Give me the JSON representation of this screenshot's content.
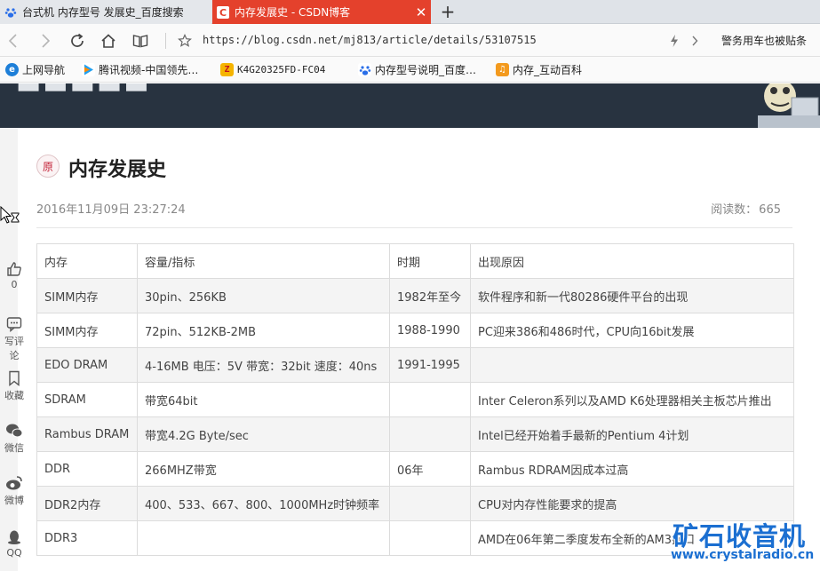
{
  "tabs": [
    {
      "title": "台式机 内存型号 发展史_百度搜索",
      "favicon": "baidu-paw-icon",
      "active": false
    },
    {
      "title": "内存发展史 - CSDN博客",
      "favicon": "csdn-c-icon",
      "active": true,
      "accent": "#e4412c"
    }
  ],
  "address": {
    "url": "https://blog.csdn.net/mj813/article/details/53107515",
    "right_text": "警务用车也被贴条"
  },
  "bookmarks": [
    {
      "label": "上网导航",
      "icon": "ie-e-icon"
    },
    {
      "label": "腾讯视频-中国领先…",
      "icon": "tencent-video-icon"
    },
    {
      "label": "K4G20325FD-FC04 ",
      "icon": "zol-icon"
    },
    {
      "label": "内存型号说明_百度…",
      "icon": "baidu-paw-icon"
    },
    {
      "label": "内存_互动百科",
      "icon": "hudong-icon"
    }
  ],
  "article": {
    "badge": "原",
    "title": "内存发展史",
    "date": "2016年11月09日 23:27:24",
    "views_label": "阅读数：",
    "views": "665"
  },
  "table": {
    "header": [
      "内存",
      "容量/指标",
      "时期",
      "出现原因"
    ],
    "rows": [
      [
        "SIMM内存",
        "30pin、256KB",
        "1982年至今",
        "软件程序和新一代80286硬件平台的出现"
      ],
      [
        "SIMM内存",
        "72pin、512KB-2MB",
        "1988-1990",
        "PC迎来386和486时代，CPU向16bit发展"
      ],
      [
        "EDO DRAM",
        "4-16MB 电压：5V 带宽：32bit 速度：40ns",
        "1991-1995",
        ""
      ],
      [
        "SDRAM",
        "带宽64bit",
        "",
        "Inter Celeron系列以及AMD K6处理器相关主板芯片推出"
      ],
      [
        "Rambus DRAM",
        "带宽4.2G Byte/sec",
        "",
        "Intel已经开始着手最新的Pentium 4计划"
      ],
      [
        "DDR",
        "266MHZ带宽",
        "06年",
        "Rambus RDRAM因成本过高"
      ],
      [
        "DDR2内存",
        "400、533、667、800、1000MHz时钟频率",
        "",
        "CPU对内存性能要求的提高"
      ],
      [
        "DDR3",
        "",
        "",
        "AMD在06年第二季度发布全新的AM3接口"
      ]
    ]
  },
  "rail": [
    {
      "label": "0",
      "icon": "thumbs-up-icon"
    },
    {
      "label": "写评论",
      "icon": "comment-icon"
    },
    {
      "label": "收藏",
      "icon": "bookmark-icon"
    },
    {
      "label": "微信",
      "icon": "wechat-icon"
    },
    {
      "label": "微博",
      "icon": "weibo-icon"
    },
    {
      "label": "QQ",
      "icon": "qq-icon"
    }
  ],
  "watermark": {
    "name": "矿石收音机",
    "url": "www.crystalradio.cn",
    "color": "#1b6fd1"
  }
}
